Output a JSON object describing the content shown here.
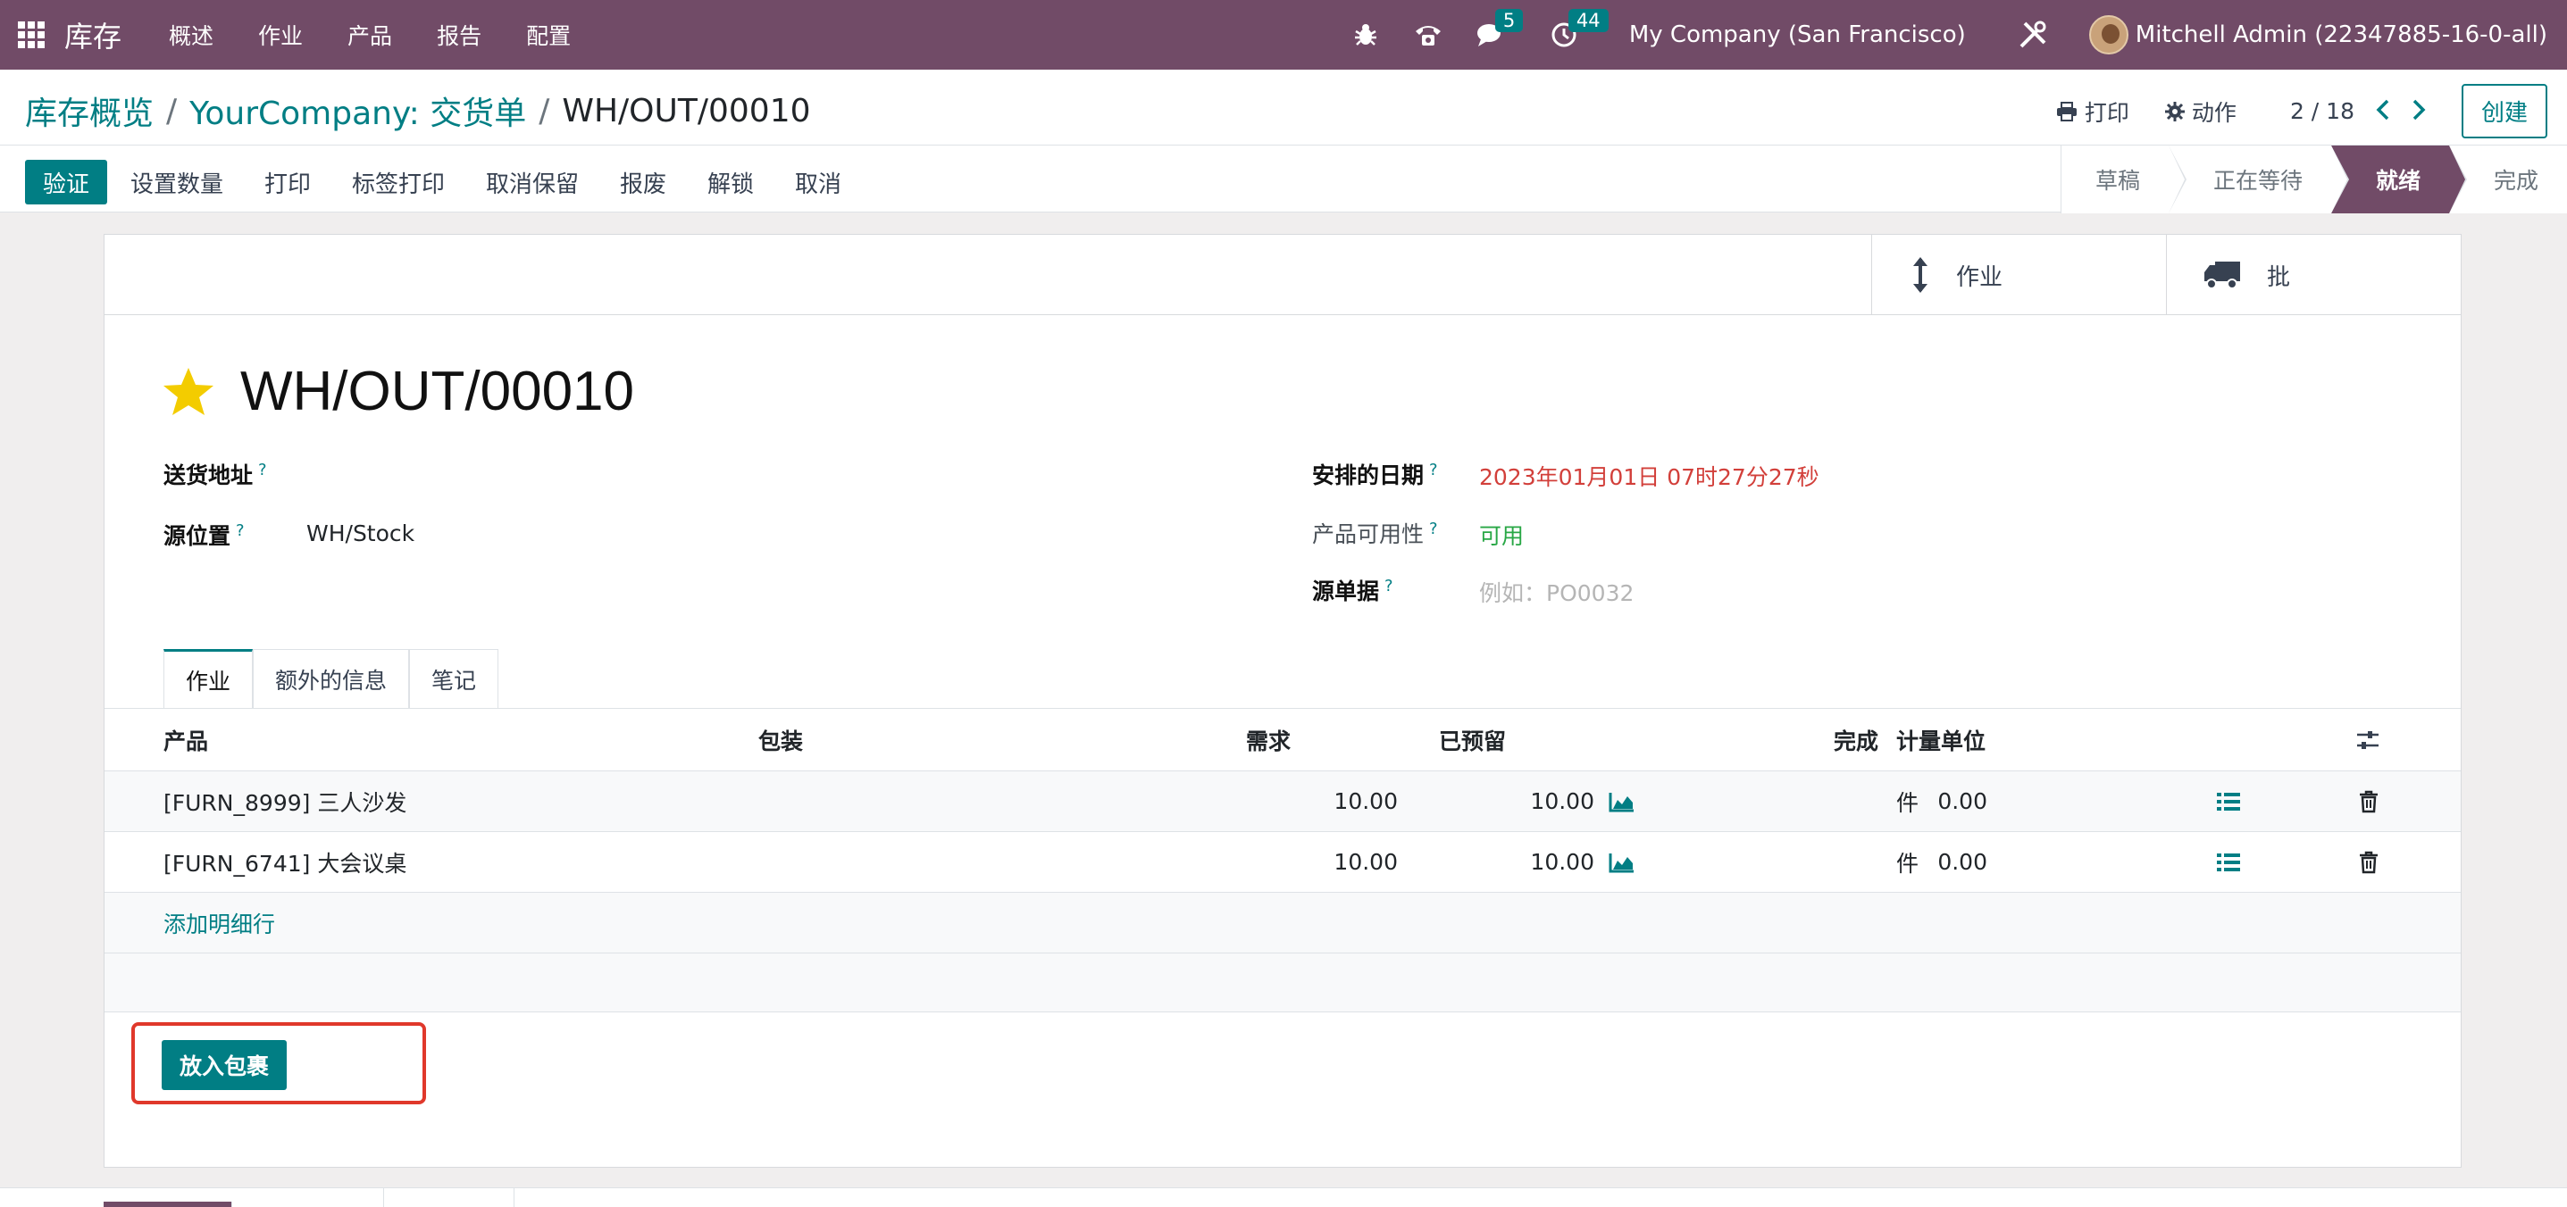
{
  "nav": {
    "app_name": "库存",
    "menus": [
      "概述",
      "作业",
      "产品",
      "报告",
      "配置"
    ],
    "messages_count": "5",
    "activities_count": "44",
    "company": "My Company (San Francisco)",
    "user": "Mitchell Admin (22347885-16-0-all)"
  },
  "breadcrumb": {
    "root": "库存概览",
    "parent": "YourCompany: 交货单",
    "current": "WH/OUT/00010",
    "separator": "/"
  },
  "control": {
    "print_label": "打印",
    "action_label": "动作",
    "pager": "2 / 18",
    "create_label": "创建"
  },
  "actions": {
    "validate": "验证",
    "set_quantities": "设置数量",
    "print": "打印",
    "label_print": "标签打印",
    "unreserve": "取消保留",
    "scrap": "报废",
    "unlock": "解锁",
    "cancel": "取消"
  },
  "status": [
    "草稿",
    "正在等待",
    "就绪",
    "完成"
  ],
  "smart_buttons": {
    "operations": "作业",
    "batch": "批"
  },
  "record": {
    "title": "WH/OUT/00010",
    "delivery_address_label": "送货地址",
    "source_location_label": "源位置",
    "source_location_value": "WH/Stock",
    "scheduled_date_label": "安排的日期",
    "scheduled_date_value": "2023年01月01日 07时27分27秒",
    "availability_label": "产品可用性",
    "availability_value": "可用",
    "source_doc_label": "源单据",
    "source_doc_placeholder": "例如：PO0032",
    "help_mark": "?"
  },
  "colors": {
    "brand": "#714b67",
    "accent": "#017e84",
    "date_red": "#d23f3a",
    "available_green": "#28a745"
  },
  "tabs": [
    "作业",
    "额外的信息",
    "笔记"
  ],
  "table": {
    "headers": {
      "product": "产品",
      "packaging": "包装",
      "demand": "需求",
      "reserved": "已预留",
      "done": "完成",
      "uom": "计量单位"
    },
    "rows": [
      {
        "product": "[FURN_8999] 三人沙发",
        "demand": "10.00",
        "reserved": "10.00",
        "done": "0.00",
        "uom": "件"
      },
      {
        "product": "[FURN_6741] 大会议桌",
        "demand": "10.00",
        "reserved": "10.00",
        "done": "0.00",
        "uom": "件"
      }
    ],
    "add_line": "添加明细行"
  },
  "put_in_pack": "放入包裹"
}
